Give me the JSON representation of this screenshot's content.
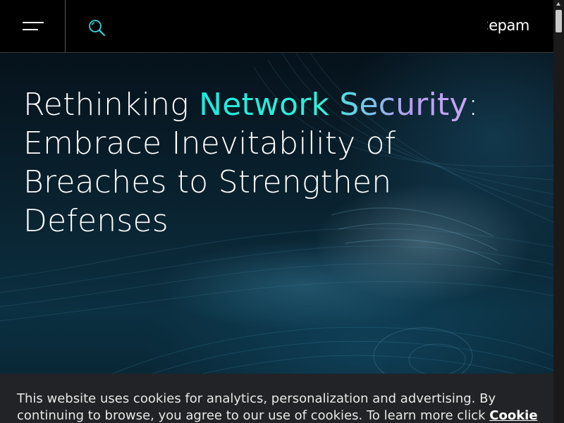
{
  "header": {
    "menu_icon": "hamburger-menu-icon",
    "search_icon": "search-icon",
    "logo_text": "<epam>"
  },
  "hero": {
    "title_prefix": "Rethinking ",
    "title_accent": "Network Security",
    "title_suffix": ": Embrace Inevitability of Breaches to Strengthen Defenses",
    "accent_colors": [
      "#1de9e0",
      "#c8a6f4"
    ]
  },
  "cookie_banner": {
    "text": "This website uses cookies for analytics, personalization and advertising. By continuing to browse, you agree to our use of cookies. To learn more click ",
    "link_label": "Cookie Policy"
  },
  "colors": {
    "header_bg": "#000000",
    "banner_bg": "#222326",
    "search_icon_color": "#2fd6e0"
  }
}
